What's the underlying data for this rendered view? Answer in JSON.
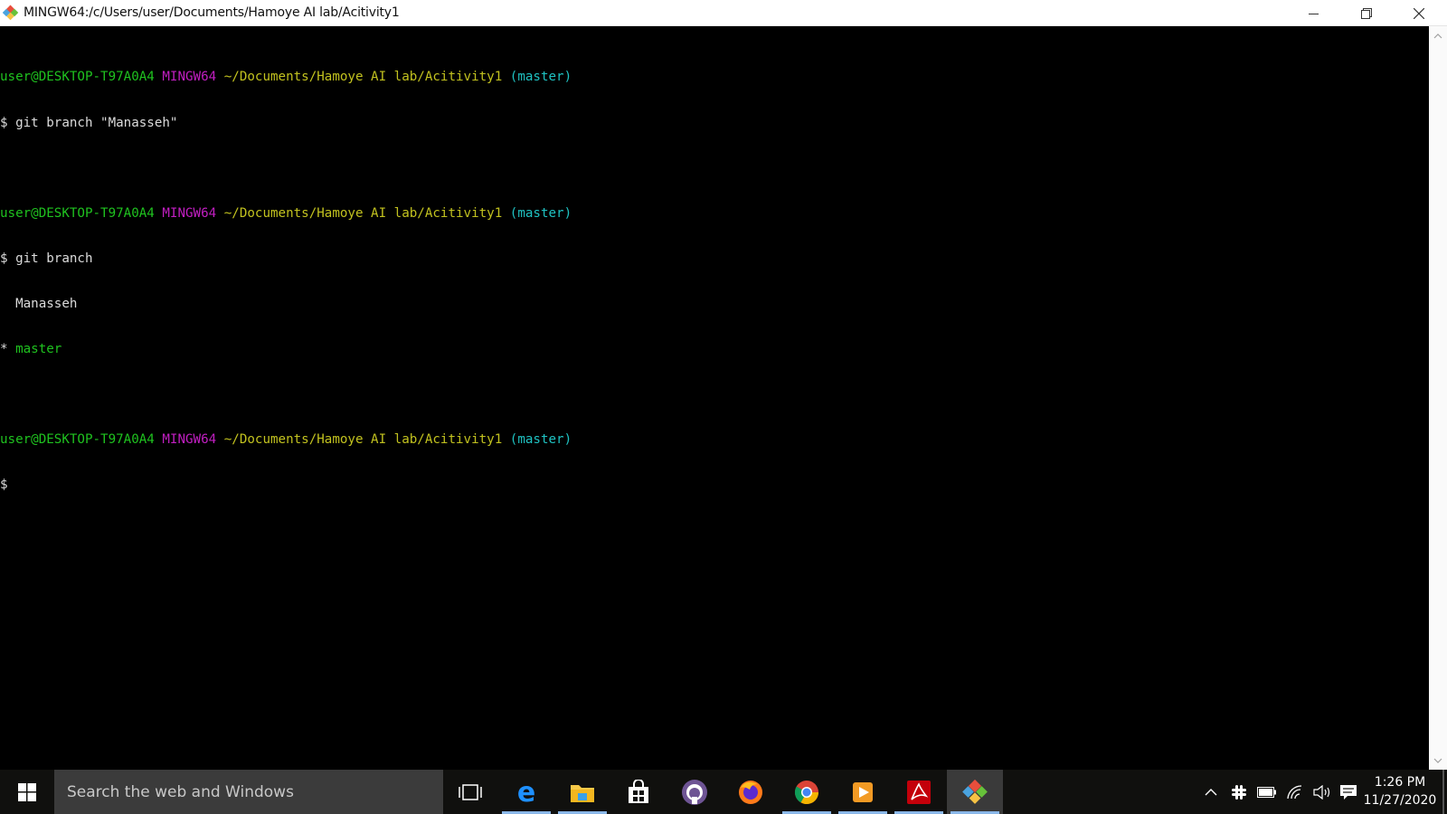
{
  "window": {
    "title": "MINGW64:/c/Users/user/Documents/Hamoye AI lab/Acitivity1",
    "app_icon": "git-bash-icon",
    "controls": [
      "minimize-icon",
      "restore-icon",
      "close-icon"
    ]
  },
  "terminal": {
    "prompt_user": "user@DESKTOP-T97A0A4",
    "prompt_system": "MINGW64",
    "prompt_path": "~/Documents/Hamoye AI lab/Acitivity1",
    "prompt_branch": "(master)",
    "cmd1": "$ git branch \"Manasseh\"",
    "cmd2": "$ git branch",
    "out_branch1": "  Manasseh",
    "out_branch2_marker": "* ",
    "out_branch2": "master",
    "cursor_prompt": "$",
    "colors": {
      "user": "#1fc21f",
      "system": "#c21fc2",
      "path": "#c2c21f",
      "branch": "#1fc2c2",
      "text": "#dcdcdc",
      "background": "#000000"
    }
  },
  "taskbar": {
    "search_placeholder": "Search the web and Windows",
    "pinned": [
      "task-view-icon",
      "edge-icon",
      "file-explorer-icon",
      "store-icon",
      "github-icon",
      "firefox-icon",
      "chrome-icon",
      "media-player-icon",
      "acrobat-icon",
      "git-bash-icon"
    ],
    "tray_icons": [
      "chevron-up-icon",
      "slack-icon",
      "battery-icon",
      "wifi-icon",
      "volume-icon",
      "notification-icon"
    ],
    "time": "1:26 PM",
    "date": "11/27/2020"
  }
}
